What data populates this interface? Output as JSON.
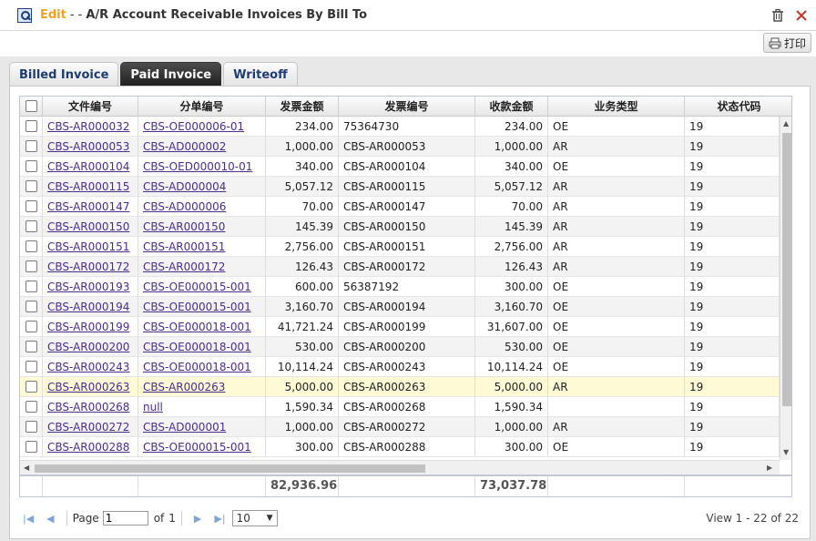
{
  "window": {
    "mode": "Edit",
    "separator": "- -",
    "title": "A/R Account Receivable Invoices By Bill To"
  },
  "toolbar": {
    "print_label": "打印"
  },
  "tabs": [
    {
      "label": "Billed Invoice",
      "active": false
    },
    {
      "label": "Paid Invoice",
      "active": true
    },
    {
      "label": "Writeoff",
      "active": false
    }
  ],
  "grid": {
    "columns": [
      "文件编号",
      "分单编号",
      "发票金额",
      "发票编号",
      "收款金额",
      "业务类型",
      "状态代码"
    ],
    "rows": [
      {
        "doc": "CBS-AR000032",
        "sub": "CBS-OE000006-01",
        "inv_amt": "234.00",
        "inv_no": "75364730",
        "recv_amt": "234.00",
        "biz": "OE",
        "status": "19"
      },
      {
        "doc": "CBS-AR000053",
        "sub": "CBS-AD000002",
        "inv_amt": "1,000.00",
        "inv_no": "CBS-AR000053",
        "recv_amt": "1,000.00",
        "biz": "AR",
        "status": "19"
      },
      {
        "doc": "CBS-AR000104",
        "sub": "CBS-OED000010-01",
        "inv_amt": "340.00",
        "inv_no": "CBS-AR000104",
        "recv_amt": "340.00",
        "biz": "OE",
        "status": "19"
      },
      {
        "doc": "CBS-AR000115",
        "sub": "CBS-AD000004",
        "inv_amt": "5,057.12",
        "inv_no": "CBS-AR000115",
        "recv_amt": "5,057.12",
        "biz": "AR",
        "status": "19"
      },
      {
        "doc": "CBS-AR000147",
        "sub": "CBS-AD000006",
        "inv_amt": "70.00",
        "inv_no": "CBS-AR000147",
        "recv_amt": "70.00",
        "biz": "AR",
        "status": "19"
      },
      {
        "doc": "CBS-AR000150",
        "sub": "CBS-AR000150",
        "inv_amt": "145.39",
        "inv_no": "CBS-AR000150",
        "recv_amt": "145.39",
        "biz": "AR",
        "status": "19"
      },
      {
        "doc": "CBS-AR000151",
        "sub": "CBS-AR000151",
        "inv_amt": "2,756.00",
        "inv_no": "CBS-AR000151",
        "recv_amt": "2,756.00",
        "biz": "AR",
        "status": "19"
      },
      {
        "doc": "CBS-AR000172",
        "sub": "CBS-AR000172",
        "inv_amt": "126.43",
        "inv_no": "CBS-AR000172",
        "recv_amt": "126.43",
        "biz": "AR",
        "status": "19"
      },
      {
        "doc": "CBS-AR000193",
        "sub": "CBS-OE000015-001",
        "inv_amt": "600.00",
        "inv_no": "56387192",
        "recv_amt": "300.00",
        "biz": "OE",
        "status": "19"
      },
      {
        "doc": "CBS-AR000194",
        "sub": "CBS-OE000015-001",
        "inv_amt": "3,160.70",
        "inv_no": "CBS-AR000194",
        "recv_amt": "3,160.70",
        "biz": "OE",
        "status": "19"
      },
      {
        "doc": "CBS-AR000199",
        "sub": "CBS-OE000018-001",
        "inv_amt": "41,721.24",
        "inv_no": "CBS-AR000199",
        "recv_amt": "31,607.00",
        "biz": "OE",
        "status": "19"
      },
      {
        "doc": "CBS-AR000200",
        "sub": "CBS-OE000018-001",
        "inv_amt": "530.00",
        "inv_no": "CBS-AR000200",
        "recv_amt": "530.00",
        "biz": "OE",
        "status": "19"
      },
      {
        "doc": "CBS-AR000243",
        "sub": "CBS-OE000018-001",
        "inv_amt": "10,114.24",
        "inv_no": "CBS-AR000243",
        "recv_amt": "10,114.24",
        "biz": "OE",
        "status": "19"
      },
      {
        "doc": "CBS-AR000263",
        "sub": "CBS-AR000263",
        "inv_amt": "5,000.00",
        "inv_no": "CBS-AR000263",
        "recv_amt": "5,000.00",
        "biz": "AR",
        "status": "19",
        "highlight": true
      },
      {
        "doc": "CBS-AR000268",
        "sub": "null",
        "inv_amt": "1,590.34",
        "inv_no": "CBS-AR000268",
        "recv_amt": "1,590.34",
        "biz": "",
        "status": "19"
      },
      {
        "doc": "CBS-AR000272",
        "sub": "CBS-AD000001",
        "inv_amt": "1,000.00",
        "inv_no": "CBS-AR000272",
        "recv_amt": "1,000.00",
        "biz": "AR",
        "status": "19"
      },
      {
        "doc": "CBS-AR000288",
        "sub": "CBS-OE000015-001",
        "inv_amt": "300.00",
        "inv_no": "CBS-AR000288",
        "recv_amt": "300.00",
        "biz": "OE",
        "status": "19"
      }
    ],
    "totals": {
      "inv_amt": "82,936.96",
      "recv_amt": "73,037.78"
    }
  },
  "pager": {
    "page_label": "Page",
    "page_value": "1",
    "of_label": "of",
    "total_pages": "1",
    "page_size": "10",
    "view_info": "View 1 - 22 of 22"
  },
  "colors": {
    "edit": "#f0a21e",
    "link": "#4b2d8c",
    "highlight_row": "#fefad6",
    "active_tab": "#2a2a2a"
  }
}
